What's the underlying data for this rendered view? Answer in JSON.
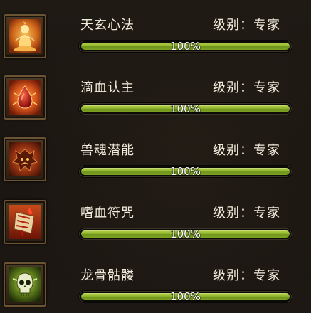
{
  "skills": [
    {
      "name": "天玄心法",
      "level_label": "级别：专家",
      "progress_text": "100%",
      "progress": 1.0,
      "icon": "meditating-monk-icon"
    },
    {
      "name": "滴血认主",
      "level_label": "级别：专家",
      "progress_text": "100%",
      "progress": 1.0,
      "icon": "blood-drop-icon"
    },
    {
      "name": "兽魂潜能",
      "level_label": "级别：专家",
      "progress_text": "100%",
      "progress": 1.0,
      "icon": "beast-soul-icon"
    },
    {
      "name": "嗜血符咒",
      "level_label": "级别：专家",
      "progress_text": "100%",
      "progress": 1.0,
      "icon": "blood-talisman-icon"
    },
    {
      "name": "龙骨骷髅",
      "level_label": "级别：专家",
      "progress_text": "100%",
      "progress": 1.0,
      "icon": "dragon-skull-icon"
    }
  ]
}
